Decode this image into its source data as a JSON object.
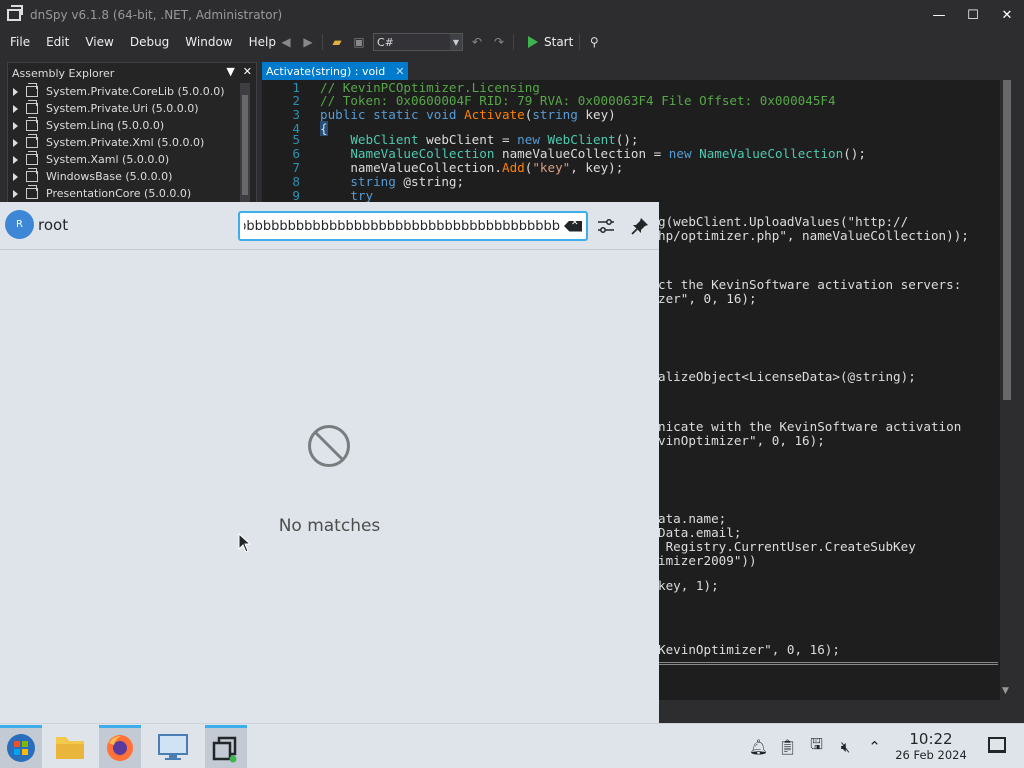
{
  "window": {
    "title": "dnSpy v6.1.8 (64-bit, .NET, Administrator)",
    "controls": {
      "minimize": "—",
      "maximize": "☐",
      "close": "✕"
    }
  },
  "menu": [
    "File",
    "Edit",
    "View",
    "Debug",
    "Window",
    "Help"
  ],
  "toolbar": {
    "language": "C#",
    "start_label": "Start"
  },
  "assembly_explorer": {
    "title": "Assembly Explorer",
    "items": [
      "System.Private.CoreLib (5.0.0.0)",
      "System.Private.Uri (5.0.0.0)",
      "System.Linq (5.0.0.0)",
      "System.Private.Xml (5.0.0.0)",
      "System.Xaml (5.0.0.0)",
      "WindowsBase (5.0.0.0)",
      "PresentationCore (5.0.0.0)"
    ]
  },
  "editor": {
    "tab_label": "Activate(string) : void",
    "line_numbers": [
      "1",
      "2",
      "3",
      "4",
      "5",
      "6",
      "7",
      "8",
      "9"
    ],
    "visible_fragments": [
      "g(webClient.UploadValues(\"http://",
      "hp/optimizer.php\", nameValueCollection));",
      "ct the KevinSoftware activation servers:",
      "zer\", 0, 16);",
      "alizeObject<LicenseData>(@string);",
      "nicate with the KevinSoftware activation",
      "vinOptimizer\", 0, 16);",
      "ata.name;",
      "Data.email;",
      " Registry.CurrentUser.CreateSubKey",
      "imizer2009\"))",
      "key, 1);",
      "KevinOptimizer\", 0, 16);"
    ]
  },
  "krunner": {
    "user_initial": "R",
    "user_name": "root",
    "query": "bbbbbbbbbbbbbbbbbbbbbbbbbbbbbbbbbbbbbbbbbbbbb",
    "empty_text": "No matches"
  },
  "taskbar": {
    "apps": [
      "start-menu",
      "file-manager",
      "firefox",
      "system-settings",
      "dnspy"
    ],
    "time": "10:22",
    "date": "26 Feb 2024"
  }
}
